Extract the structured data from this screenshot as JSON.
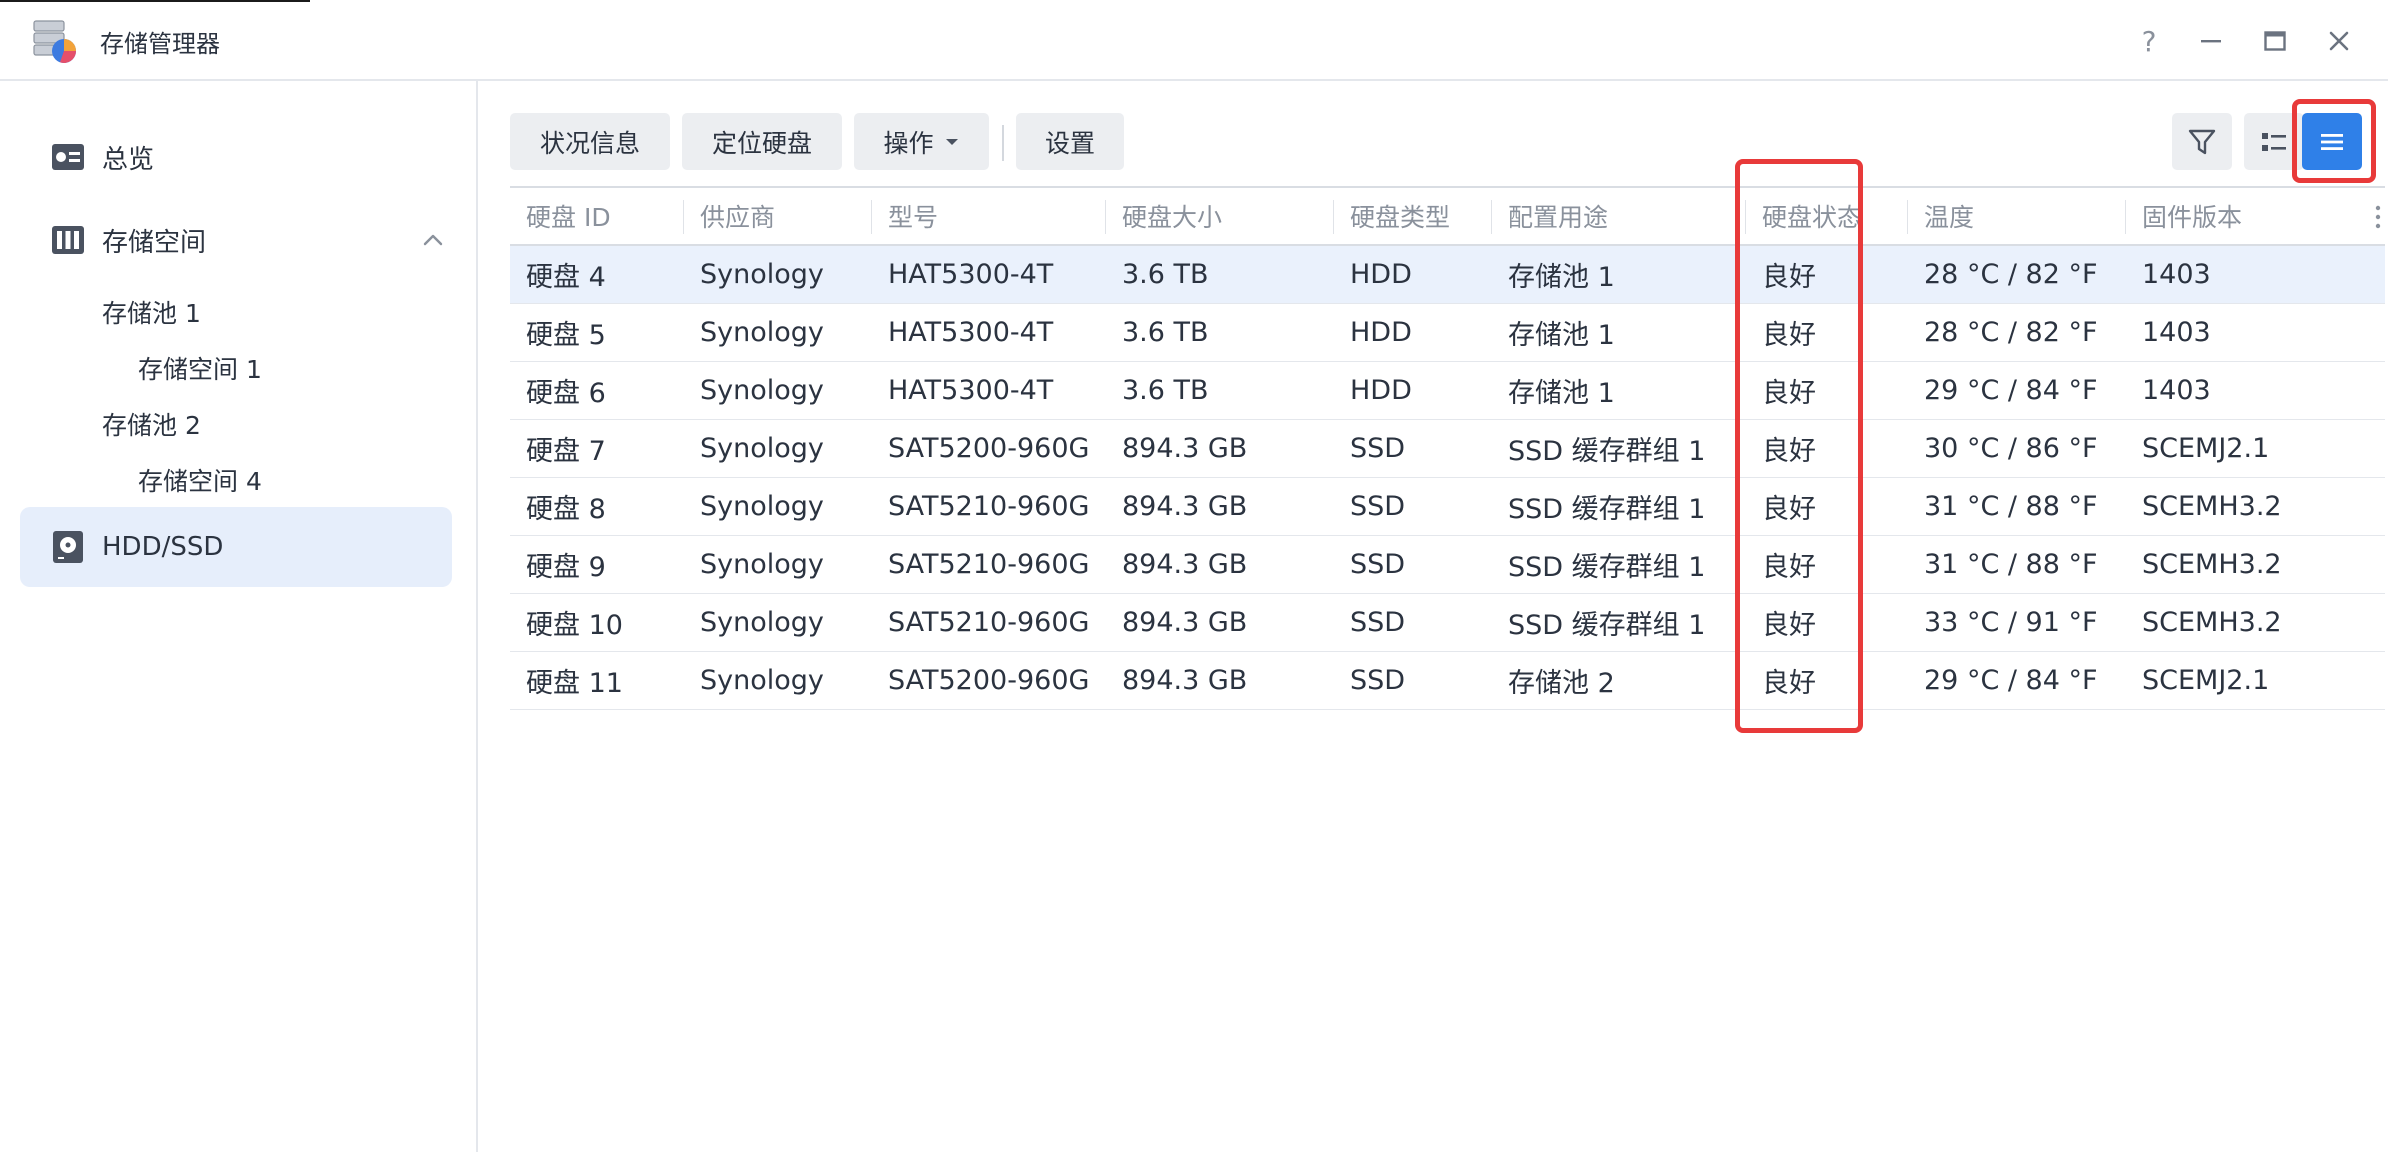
{
  "window": {
    "title": "存储管理器",
    "help_label": "?"
  },
  "sidebar": {
    "items": [
      {
        "label": "总览",
        "icon": "overview-icon"
      },
      {
        "label": "存储空间",
        "icon": "storage-icon",
        "expanded": true
      },
      {
        "label": "HDD/SSD",
        "icon": "disk-icon",
        "active": true
      }
    ],
    "tree": [
      {
        "label": "存储池 1"
      },
      {
        "label": "存储空间 1"
      },
      {
        "label": "存储池 2"
      },
      {
        "label": "存储空间 4"
      }
    ]
  },
  "toolbar": {
    "status_label": "状况信息",
    "locate_label": "定位硬盘",
    "action_label": "操作",
    "settings_label": "设置"
  },
  "table": {
    "columns": [
      "硬盘 ID",
      "供应商",
      "型号",
      "硬盘大小",
      "硬盘类型",
      "配置用途",
      "硬盘状态",
      "温度",
      "固件版本"
    ],
    "rows": [
      [
        "硬盘 4",
        "Synology",
        "HAT5300-4T",
        "3.6 TB",
        "HDD",
        "存储池 1",
        "良好",
        "28 °C / 82 °F",
        "1403"
      ],
      [
        "硬盘 5",
        "Synology",
        "HAT5300-4T",
        "3.6 TB",
        "HDD",
        "存储池 1",
        "良好",
        "28 °C / 82 °F",
        "1403"
      ],
      [
        "硬盘 6",
        "Synology",
        "HAT5300-4T",
        "3.6 TB",
        "HDD",
        "存储池 1",
        "良好",
        "29 °C / 84 °F",
        "1403"
      ],
      [
        "硬盘 7",
        "Synology",
        "SAT5200-960G",
        "894.3 GB",
        "SSD",
        "SSD 缓存群组 1",
        "良好",
        "30 °C / 86 °F",
        "SCEMJ2.1"
      ],
      [
        "硬盘 8",
        "Synology",
        "SAT5210-960G",
        "894.3 GB",
        "SSD",
        "SSD 缓存群组 1",
        "良好",
        "31 °C / 88 °F",
        "SCEMH3.2"
      ],
      [
        "硬盘 9",
        "Synology",
        "SAT5210-960G",
        "894.3 GB",
        "SSD",
        "SSD 缓存群组 1",
        "良好",
        "31 °C / 88 °F",
        "SCEMH3.2"
      ],
      [
        "硬盘 10",
        "Synology",
        "SAT5210-960G",
        "894.3 GB",
        "SSD",
        "SSD 缓存群组 1",
        "良好",
        "33 °C / 91 °F",
        "SCEMH3.2"
      ],
      [
        "硬盘 11",
        "Synology",
        "SAT5200-960G",
        "894.3 GB",
        "SSD",
        "存储池 2",
        "良好",
        "29 °C / 84 °F",
        "SCEMJ2.1"
      ]
    ],
    "selected_row": 0
  },
  "colors": {
    "accent": "#2f80e8",
    "status_good": "#2e9b2e",
    "highlight": "#e83a3a",
    "selected_row": "#eaf1fc"
  }
}
